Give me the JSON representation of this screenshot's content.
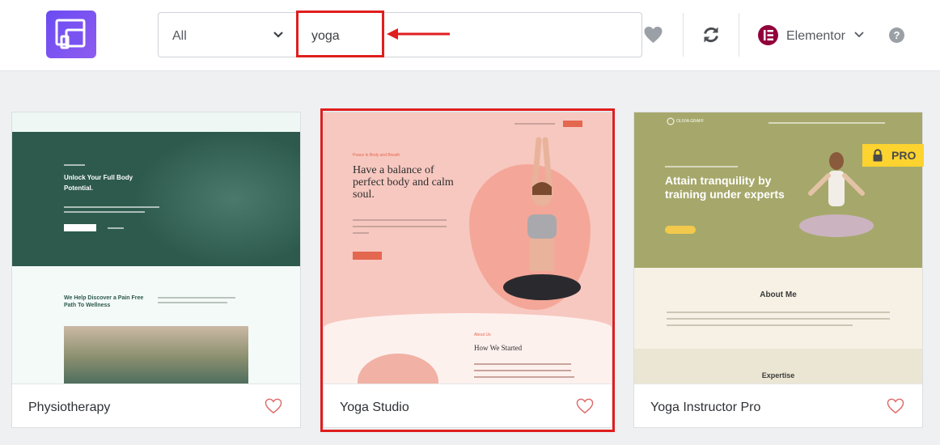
{
  "header": {
    "filter": {
      "selected": "All"
    },
    "search": {
      "value": "yoga",
      "placeholder": ""
    },
    "platform": {
      "label": "Elementor",
      "badge": "E"
    },
    "help": "?"
  },
  "colors": {
    "accent": "#6a4bf2",
    "highlight": "#e01e1e",
    "elementor": "#92003b",
    "pro": "#fcd32f"
  },
  "cards": [
    {
      "title": "Physiotherapy",
      "preview": {
        "hero_title": "Unlock Your Full Body Potential.",
        "section_title": "We Help Discover a Pain Free Path To Wellness"
      }
    },
    {
      "title": "Yoga Studio",
      "preview": {
        "eyebrow": "Peace in Body and Breath",
        "hero_title": "Have a balance of perfect body and calm soul.",
        "about_eyebrow": "About Us",
        "section_title": "How We Started"
      }
    },
    {
      "title": "Yoga Instructor Pro",
      "badge": "PRO",
      "preview": {
        "brand": "OLIVIA GRAFF",
        "hero_title": "Attain tranquility by training under experts",
        "section_title": "About Me",
        "footer_title": "Expertise"
      }
    }
  ],
  "icons": [
    "app-logo-icon",
    "chevron-down-icon",
    "heart-icon",
    "sync-icon",
    "elementor-icon",
    "help-icon",
    "lock-icon"
  ]
}
